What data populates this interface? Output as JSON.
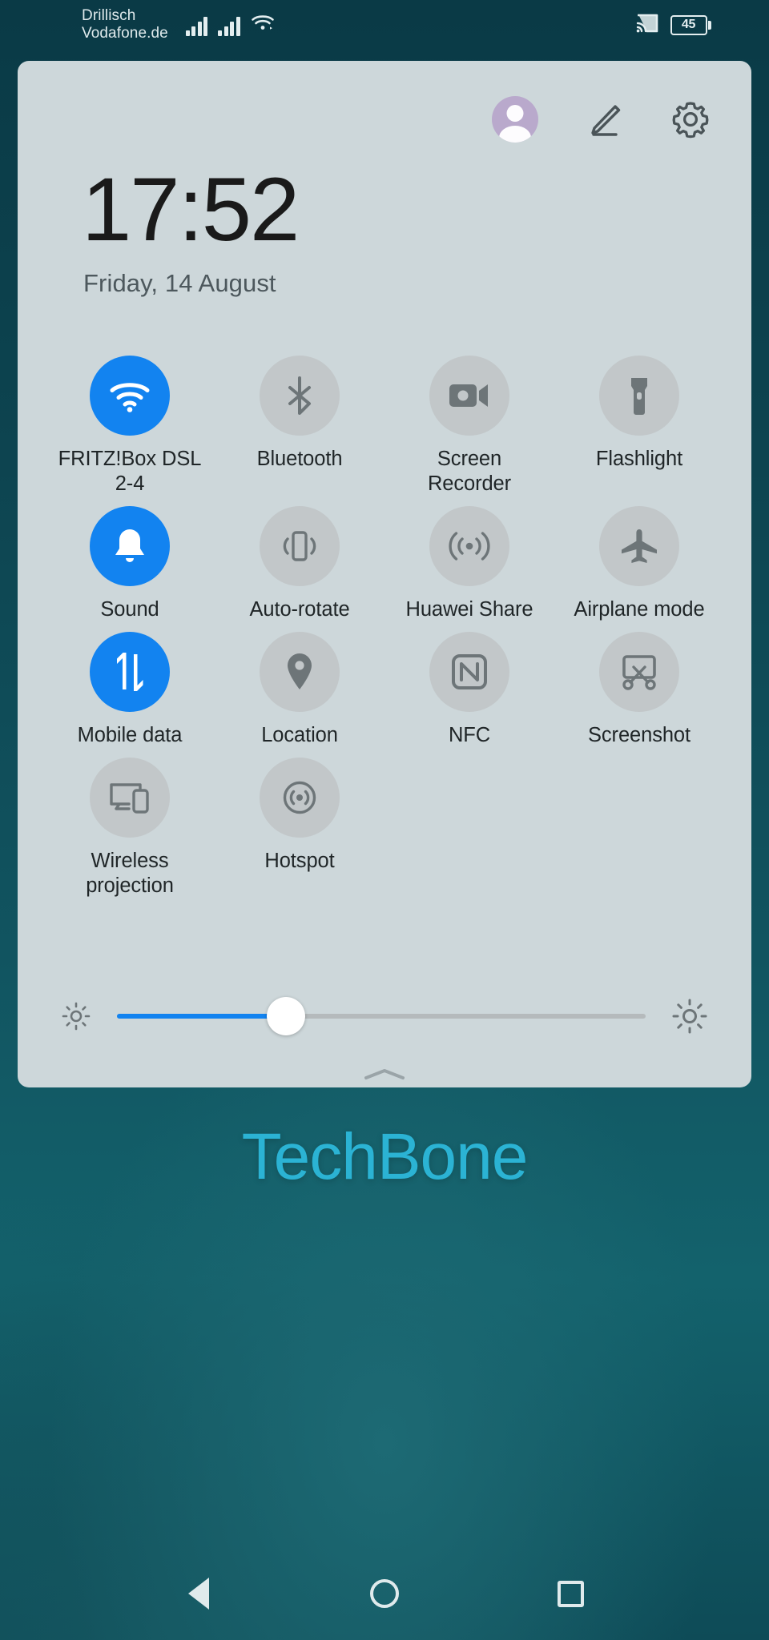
{
  "status_bar": {
    "carrier_line1": "Drillisch",
    "carrier_line2": "Vodafone.de",
    "signal_icon_1": "cellular-signal-icon",
    "signal_icon_2": "cellular-signal-icon",
    "wifi_icon": "wifi-icon",
    "cast_icon": "cast-icon",
    "battery_icon": "battery-icon",
    "battery_level": "45"
  },
  "quick_settings": {
    "avatar_icon": "user-avatar",
    "edit_icon": "pencil-edit-icon",
    "settings_icon": "gear-icon",
    "time": "17:52",
    "date": "Friday, 14 August",
    "tiles": [
      {
        "label": "FRITZ!Box DSL 2-4",
        "icon": "wifi-icon",
        "active": true
      },
      {
        "label": "Bluetooth",
        "icon": "bluetooth-icon",
        "active": false
      },
      {
        "label": "Screen Recorder",
        "icon": "screen-recorder-icon",
        "active": false
      },
      {
        "label": "Flashlight",
        "icon": "flashlight-icon",
        "active": false
      },
      {
        "label": "Sound",
        "icon": "bell-icon",
        "active": true
      },
      {
        "label": "Auto-rotate",
        "icon": "auto-rotate-icon",
        "active": false
      },
      {
        "label": "Huawei Share",
        "icon": "huawei-share-icon",
        "active": false
      },
      {
        "label": "Airplane mode",
        "icon": "airplane-icon",
        "active": false
      },
      {
        "label": "Mobile data",
        "icon": "mobile-data-icon",
        "active": true
      },
      {
        "label": "Location",
        "icon": "location-pin-icon",
        "active": false
      },
      {
        "label": "NFC",
        "icon": "nfc-icon",
        "active": false
      },
      {
        "label": "Screenshot",
        "icon": "screenshot-icon",
        "active": false
      },
      {
        "label": "Wireless projection",
        "icon": "wireless-projection-icon",
        "active": false
      },
      {
        "label": "Hotspot",
        "icon": "hotspot-icon",
        "active": false
      }
    ],
    "brightness": {
      "low_icon": "brightness-low-icon",
      "high_icon": "brightness-high-icon",
      "value_percent": 32
    },
    "handle_icon": "collapse-handle-icon"
  },
  "watermark": "TechBone",
  "nav_bar": {
    "back_icon": "back-triangle-icon",
    "home_icon": "home-circle-icon",
    "recents_icon": "recents-square-icon"
  },
  "colors": {
    "accent": "#1283f0",
    "panel": "#cdd7da",
    "tile_inactive": "#c2c7c9",
    "watermark": "#2bb3d4"
  }
}
